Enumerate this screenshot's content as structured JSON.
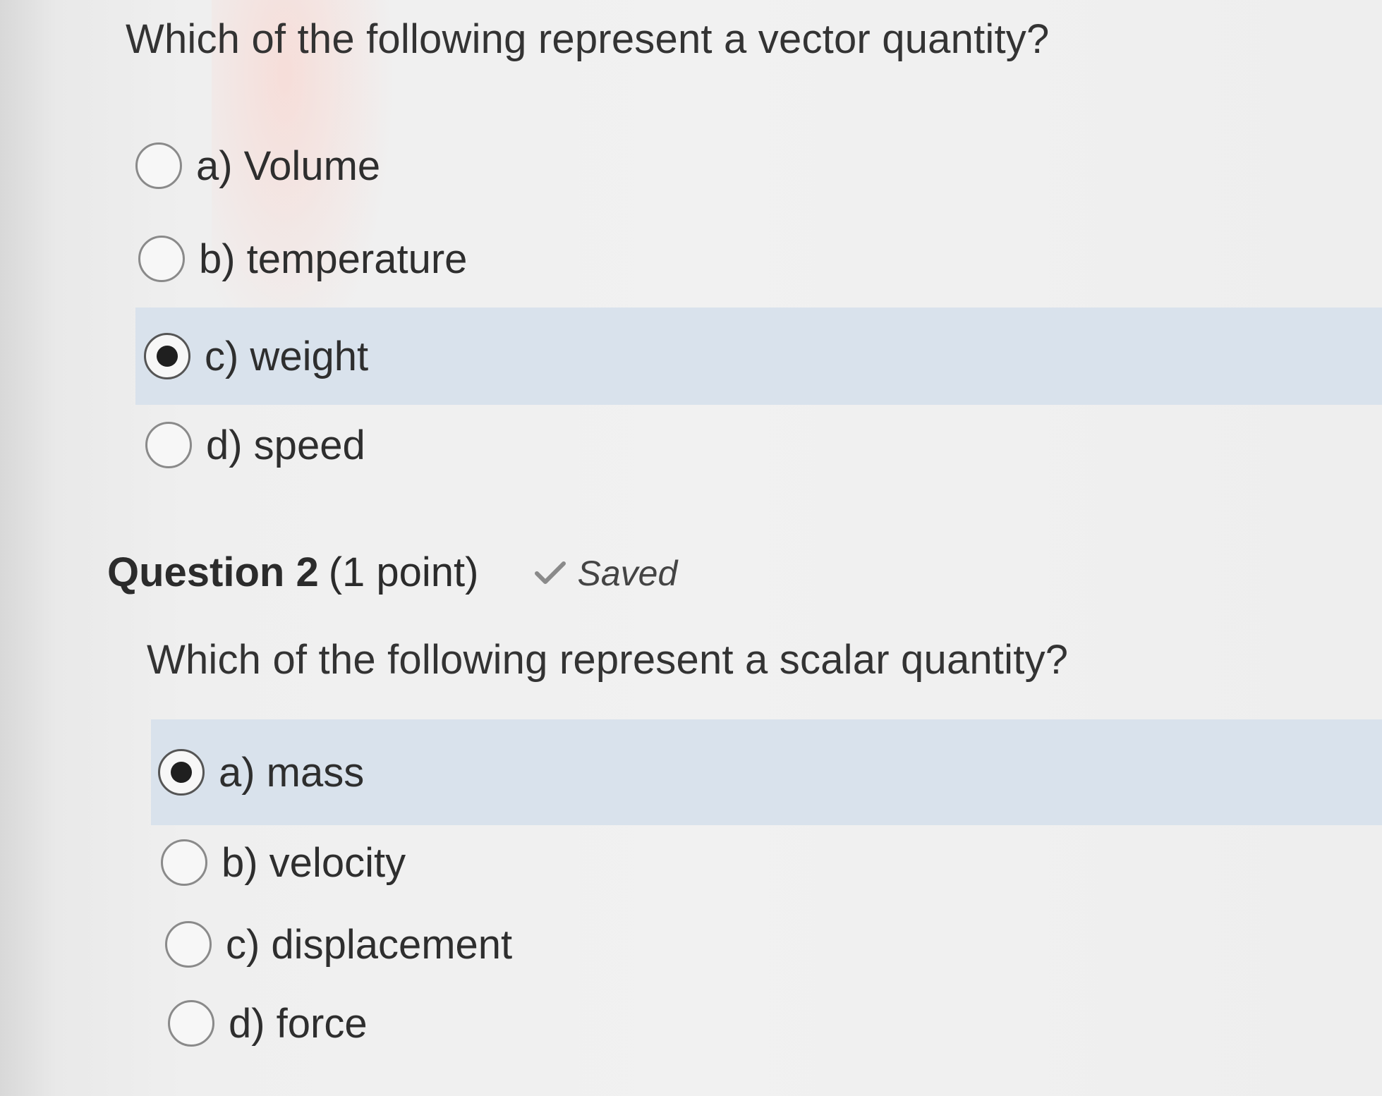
{
  "question1": {
    "prompt": "Which of the following represent a vector quantity?",
    "options": [
      {
        "label": "a) Volume",
        "selected": false
      },
      {
        "label": "b)  temperature",
        "selected": false
      },
      {
        "label": "c) weight",
        "selected": true
      },
      {
        "label": "d) speed",
        "selected": false
      }
    ]
  },
  "question2": {
    "title": "Question 2",
    "points": "(1 point)",
    "status": "Saved",
    "status_icon": "checkmark-icon",
    "prompt": "Which of the following represent a scalar quantity?",
    "options": [
      {
        "label": "a) mass",
        "selected": true
      },
      {
        "label": "b) velocity",
        "selected": false
      },
      {
        "label": "c) displacement",
        "selected": false
      },
      {
        "label": "d) force",
        "selected": false
      }
    ]
  },
  "colors": {
    "selected_row": "#d9e2ec",
    "radio_border": "#8a8a8a",
    "text": "#2e2e2e"
  }
}
